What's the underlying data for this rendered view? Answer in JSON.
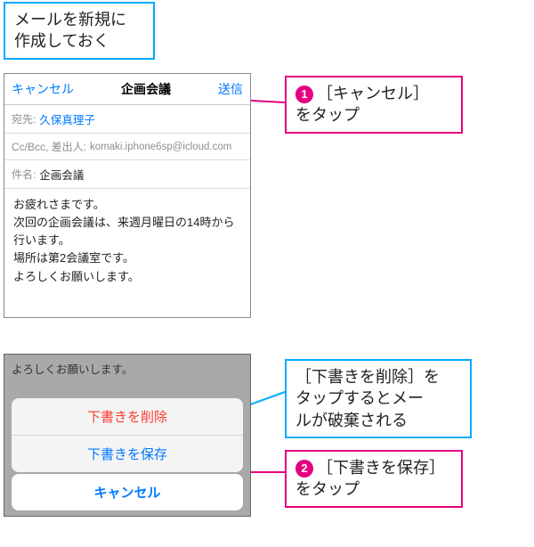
{
  "callouts": {
    "top": "メールを新規に\n作成しておく",
    "step1": "［キャンセル］\nをタップ",
    "info": "［下書きを削除］を\nタップするとメー\nルが破棄される",
    "step2": "［下書きを保存］\nをタップ",
    "badge1": "1",
    "badge2": "2"
  },
  "compose": {
    "cancel": "キャンセル",
    "title": "企画会議",
    "send": "送信",
    "to_label": "宛先:",
    "to_value": "久保真理子",
    "ccbcc_label": "Cc/Bcc, 差出人:",
    "ccbcc_value": "komaki.iphone6sp@icloud.com",
    "subject_label": "件名:",
    "subject_value": "企画会議",
    "body": "お疲れさまです。\n次回の企画会議は、来週月曜日の14時から行います。\n場所は第2会議室です。\nよろしくお願いします。"
  },
  "sheet": {
    "bg_text": "よろしくお願いします。",
    "delete": "下書きを削除",
    "save": "下書きを保存",
    "cancel": "キャンセル"
  }
}
